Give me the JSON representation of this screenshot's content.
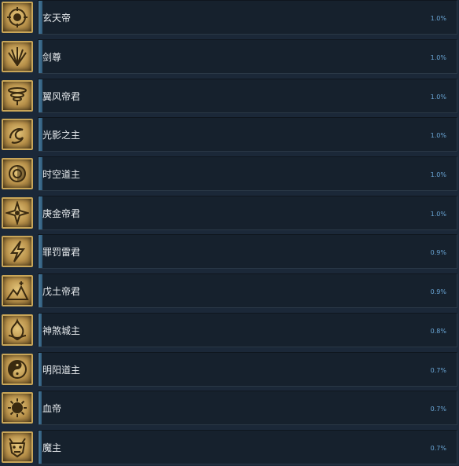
{
  "colors": {
    "background": "#1b2838",
    "bar": "#4a7a9c",
    "percent": "#6aa6d6",
    "icon_border": "#c9a658"
  },
  "achievements": [
    {
      "name": "玄天帝",
      "percent": "1.0%",
      "icon": "sun-emblem-icon"
    },
    {
      "name": "剑尊",
      "percent": "1.0%",
      "icon": "swords-icon"
    },
    {
      "name": "翼风帝君",
      "percent": "1.0%",
      "icon": "whirlwind-icon"
    },
    {
      "name": "光影之主",
      "percent": "1.0%",
      "icon": "swirl-icon"
    },
    {
      "name": "时空道主",
      "percent": "1.0%",
      "icon": "vortex-icon"
    },
    {
      "name": "庚金帝君",
      "percent": "1.0%",
      "icon": "compass-star-icon"
    },
    {
      "name": "罪罚雷君",
      "percent": "0.9%",
      "icon": "lightning-icon"
    },
    {
      "name": "戊土帝君",
      "percent": "0.9%",
      "icon": "mountain-icon"
    },
    {
      "name": "神煞城主",
      "percent": "0.8%",
      "icon": "flame-icon"
    },
    {
      "name": "明阳道主",
      "percent": "0.7%",
      "icon": "yin-yang-icon"
    },
    {
      "name": "血帝",
      "percent": "0.7%",
      "icon": "blood-orb-icon"
    },
    {
      "name": "魔主",
      "percent": "0.7%",
      "icon": "demon-mask-icon"
    }
  ]
}
